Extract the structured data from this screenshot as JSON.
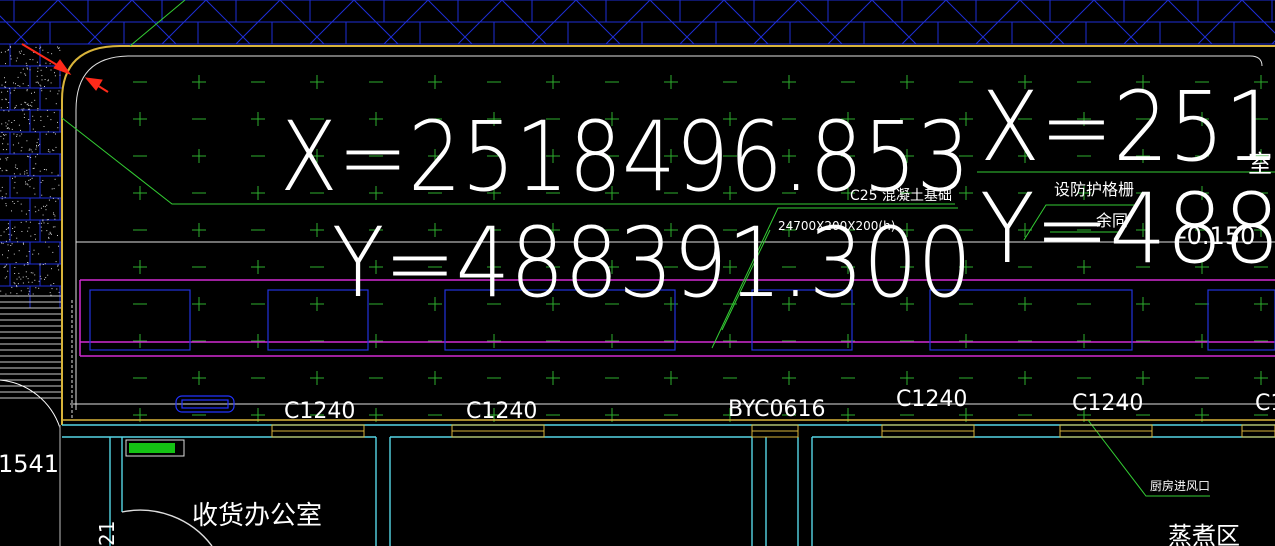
{
  "drawing": {
    "coords": {
      "x_main": "X=2518496.853",
      "y_main": "Y=488391.300",
      "x_right": "X=251",
      "y_right": "Y=488"
    },
    "labels": {
      "c25_foundation": "C25 混凝土基础",
      "foundation_size": "24700X200X200(h)",
      "guard_grille": "设防护格栅",
      "yu_tong": "余同",
      "elevation": "-0.150",
      "room_shi": "室",
      "left_edge_num": "1541",
      "receiving_office": "收货办公室",
      "kitchen_vent": "厨房进风口",
      "cooking_area": "蒸煮区",
      "bottom_edge_num": "21"
    },
    "windows": [
      "C1240",
      "C1240",
      "BYC0616",
      "C1240",
      "C1240",
      "C1"
    ],
    "colors": {
      "background": "#000000",
      "grid_blue": "#2222cc",
      "hatch_blue": "#1e2ed6",
      "border_yellow": "#d9b43a",
      "wall_cyan": "#55d6e6",
      "magenta": "#d22ad2",
      "green_cross": "#2eae2e",
      "white_text": "#ffffff",
      "leader_green": "#33cc33",
      "red_arrow": "#ff2a1a"
    }
  }
}
